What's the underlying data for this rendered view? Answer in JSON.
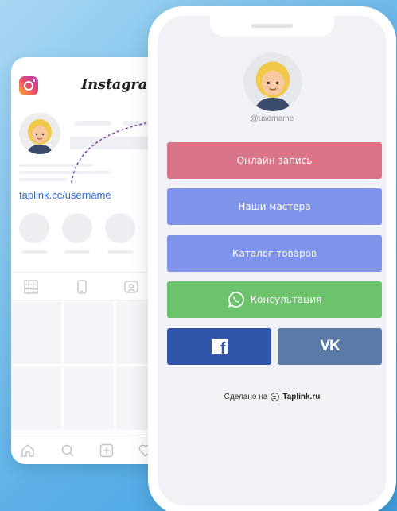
{
  "instagram": {
    "title": "Instagram",
    "link_text": "taplink.cc/username",
    "icons": [
      "instagram-logo-icon",
      "grid-icon",
      "phone-icon",
      "tag-icon",
      "home-icon",
      "search-icon",
      "plus-icon",
      "heart-icon"
    ]
  },
  "taplink": {
    "username": "@username",
    "buttons": [
      {
        "label": "Онлайн запись",
        "color": "#d97489"
      },
      {
        "label": "Наши мастера",
        "color": "#7f93ea"
      },
      {
        "label": "Каталог товаров",
        "color": "#7f93ea"
      },
      {
        "label": "Консультация",
        "color": "#6cc36c",
        "icon": "whatsapp-icon"
      }
    ],
    "social": [
      {
        "icon": "facebook-icon",
        "glyph": "f",
        "color": "#2f56a8"
      },
      {
        "icon": "vk-icon",
        "glyph": "VK",
        "color": "#5b7aa6"
      }
    ],
    "footer": {
      "prefix": "Сделано на",
      "brand": "Taplink.ru"
    }
  },
  "colors": {
    "background": "#5fb2e8",
    "link": "#2f6bd6",
    "arrow": "#8a3fb8"
  }
}
